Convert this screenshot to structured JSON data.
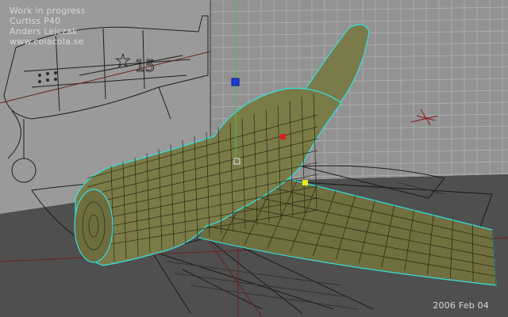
{
  "overlay": {
    "line1": "Work in progress",
    "line2": "Curtiss P40",
    "line3": "Anders Lejczak",
    "line4": "www.colacola.se"
  },
  "date": "2006 Feb 04",
  "blueprint_text": {
    "tail_number": "15",
    "star": "★"
  },
  "colors": {
    "background": "#4a4a4a",
    "floor": "#5a5a5a",
    "back_wall": "#8e8e8e",
    "grid_line": "#a8a8a8",
    "mesh_fill": "#7a7a4a",
    "mesh_line": "#2a2a1a",
    "selection_outline": "#33e0e0",
    "axis_green": "#3cc83c",
    "axis_red": "#8c1818",
    "manip_blue": "#1e3cdc",
    "manip_red": "#dc1e1e",
    "manip_yellow": "#e8e81e"
  },
  "viewport": {
    "model": "Curtiss P40 wireframe",
    "handles": [
      "blue-handle",
      "red-handle",
      "yellow-handle",
      "pivot-handle"
    ]
  }
}
